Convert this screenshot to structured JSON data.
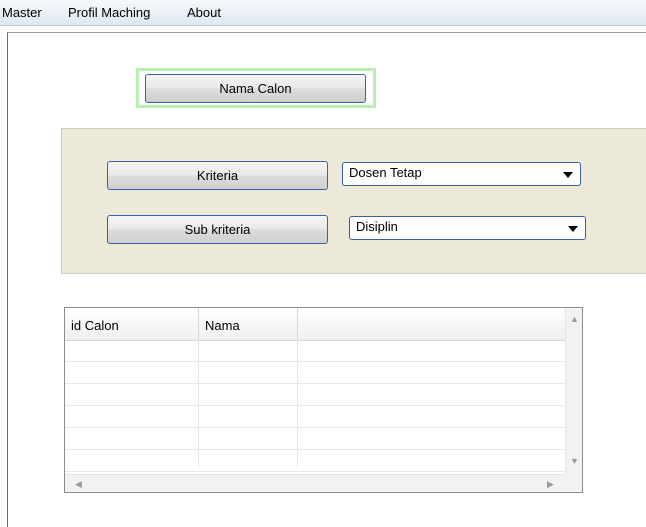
{
  "menu": {
    "items": [
      {
        "label": "Master"
      },
      {
        "label": "Profil Maching"
      },
      {
        "label": "About"
      }
    ]
  },
  "buttons": {
    "nama_calon": "Nama Calon",
    "kriteria": "Kriteria",
    "sub_kriteria": "Sub kriteria"
  },
  "dropdowns": {
    "kriteria_selected": "Dosen Tetap",
    "sub_kriteria_selected": "Disiplin"
  },
  "grid": {
    "columns": [
      "id Calon",
      "Nama"
    ],
    "rows": [],
    "empty_row_count": 6
  },
  "colors": {
    "focus_ring": "#b8f0b0",
    "panel_bg": "#ece9d8",
    "button_border": "#3a5ea8"
  },
  "icons": {
    "dropdown_arrow": "chevron-down-icon",
    "scroll_up": "scroll-up-arrow-icon",
    "scroll_down": "scroll-down-arrow-icon",
    "scroll_left": "scroll-left-arrow-icon",
    "scroll_right": "scroll-right-arrow-icon"
  }
}
